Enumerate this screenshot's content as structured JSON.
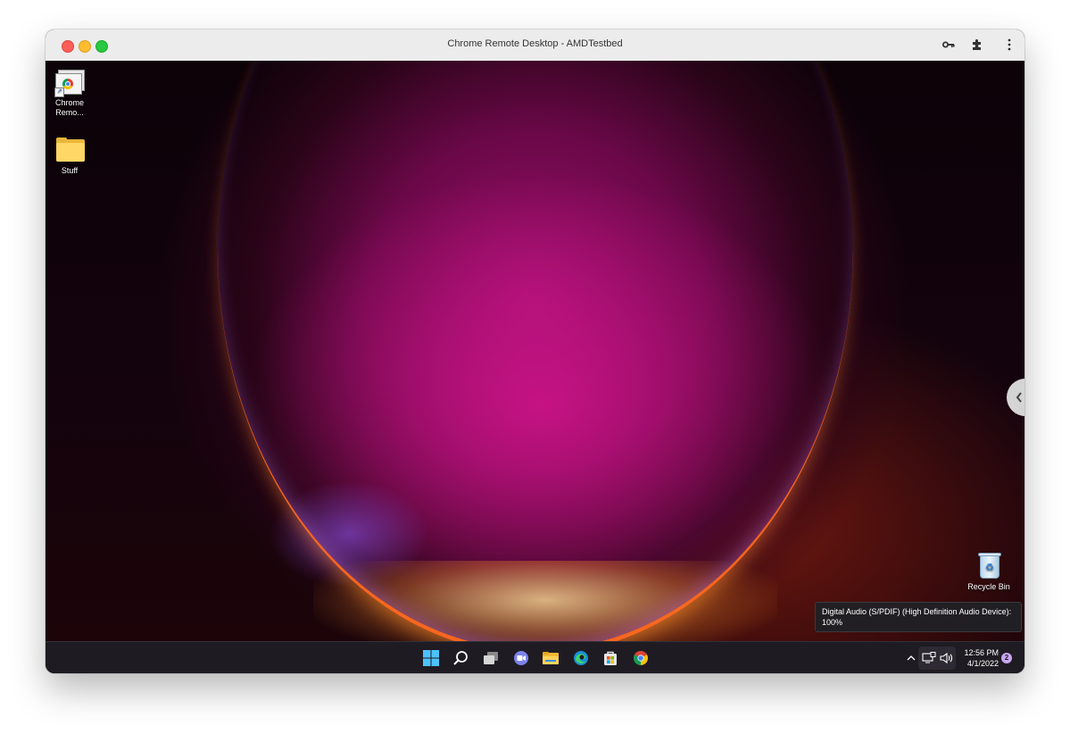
{
  "window": {
    "title": "Chrome Remote Desktop - AMDTestbed"
  },
  "toolbar": {
    "icons": [
      "key-icon",
      "extensions-icon",
      "menu-icon"
    ]
  },
  "desktop": {
    "icons": [
      {
        "label_line1": "Chrome",
        "label_line2": "Remo...",
        "icon": "chrome-remote-desktop-shortcut-icon"
      },
      {
        "label": "Stuff",
        "icon": "folder-icon"
      },
      {
        "label": "Recycle Bin",
        "icon": "recycle-bin-icon"
      }
    ]
  },
  "tooltip": {
    "line1": "Digital Audio (S/PDIF) (High Definition Audio Device):",
    "line2": "100%"
  },
  "taskbar": {
    "apps": [
      "start-icon",
      "search-icon",
      "task-view-icon",
      "chat-icon",
      "file-explorer-icon",
      "edge-icon",
      "store-icon",
      "chrome-icon"
    ],
    "time": "12:56 PM",
    "date": "4/1/2022",
    "notification_count": "2"
  },
  "colors": {
    "accent": "#0078d4",
    "taskbar_bg": "#1f1b22"
  }
}
